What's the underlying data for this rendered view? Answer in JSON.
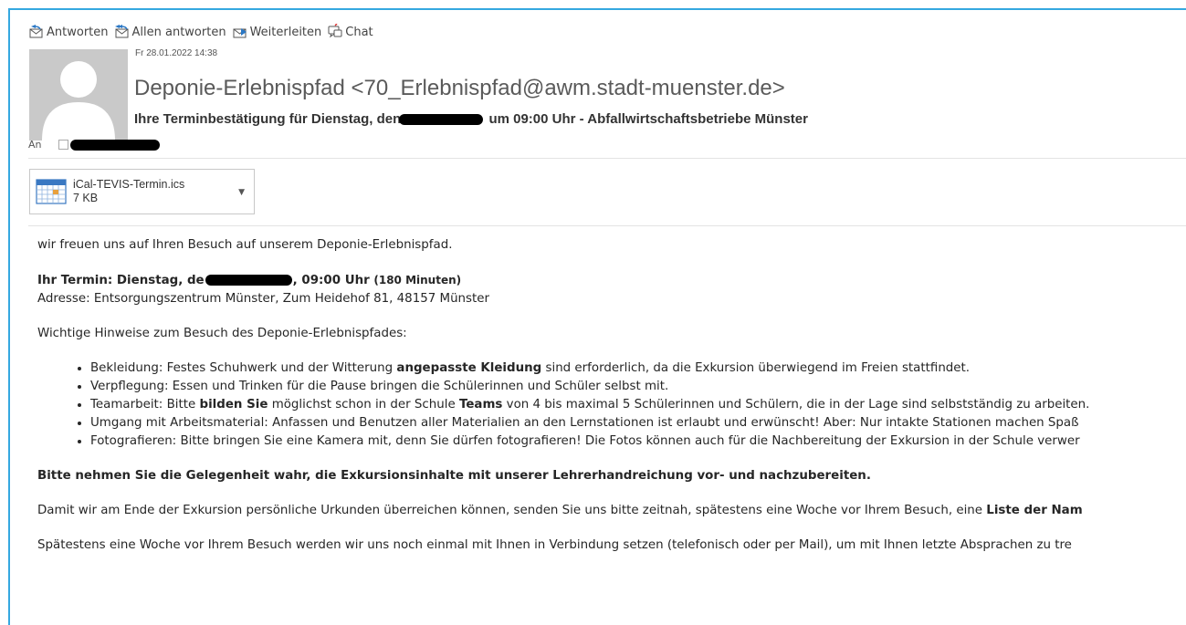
{
  "toolbar": {
    "reply": "Antworten",
    "reply_all": "Allen antworten",
    "forward": "Weiterleiten",
    "chat": "Chat"
  },
  "header": {
    "date": "Fr 28.01.2022 14:38",
    "sender": "Deponie-Erlebnispfad <70_Erlebnispfad@awm.stadt-muenster.de>",
    "subject_pre": "Ihre Terminbestätigung für Dienstag, den",
    "subject_post": "um 09:00 Uhr - Abfallwirtschaftsbetriebe Münster",
    "to_label": "An"
  },
  "attachment": {
    "name": "iCal-TEVIS-Termin.ics",
    "size": "7 KB",
    "icon": "calendar-file-icon"
  },
  "body": {
    "greeting": "wir freuen uns auf Ihren Besuch auf unserem Deponie-Erlebnispfad.",
    "termin_pre": "Ihr Termin: Dienstag, de",
    "termin_post": ", 09:00 Uhr",
    "termin_duration": "(180 Minuten)",
    "address": "Adresse: Entsorgungszentrum Münster, Zum Heidehof 81, 48157 Münster",
    "hints_title": "Wichtige Hinweise zum Besuch des Deponie-Erlebnispfades:",
    "b1_pre": "Bekleidung: Festes Schuhwerk und der Witterung ",
    "b1_bold": "angepasste Kleidung",
    "b1_post": " sind erforderlich, da die Exkursion überwiegend im Freien stattfindet.",
    "b2": "Verpflegung: Essen und Trinken für die Pause bringen die Schülerinnen und Schüler selbst mit.",
    "b3_pre": "Teamarbeit: Bitte ",
    "b3_bold1": "bilden Sie",
    "b3_mid": " möglichst schon in der Schule ",
    "b3_bold2": "Teams",
    "b3_post": " von 4 bis maximal 5 Schülerinnen und Schülern, die in der Lage sind selbstständig zu arbeiten.",
    "b4": "Umgang mit Arbeitsmaterial: Anfassen und Benutzen aller Materialien an den Lernstationen ist erlaubt und erwünscht! Aber: Nur intakte Stationen machen Spaß",
    "b5": "Fotografieren: Bitte bringen Sie eine Kamera mit, denn Sie dürfen fotografieren! Die Fotos können auch für die Nachbereitung der Exkursion in der Schule verwer",
    "gelegenheit": "Bitte nehmen Sie die Gelegenheit wahr, die Exkursionsinhalte mit unserer Lehrerhandreichung vor- und nachzubereiten.",
    "urkunden_pre": "Damit wir am Ende der Exkursion persönliche Urkunden überreichen können, senden Sie uns bitte zeitnah, spätestens eine Woche vor Ihrem Besuch, eine ",
    "urkunden_bold": "Liste der Nam",
    "spaetestens": "Spätestens eine Woche vor Ihrem Besuch werden wir uns noch einmal mit Ihnen in Verbindung setzen (telefonisch oder per Mail), um mit Ihnen letzte Absprachen zu tre"
  },
  "colors": {
    "accent_border": "#35a8e0",
    "text": "#262626",
    "avatar_bg": "#c9c9c9"
  }
}
